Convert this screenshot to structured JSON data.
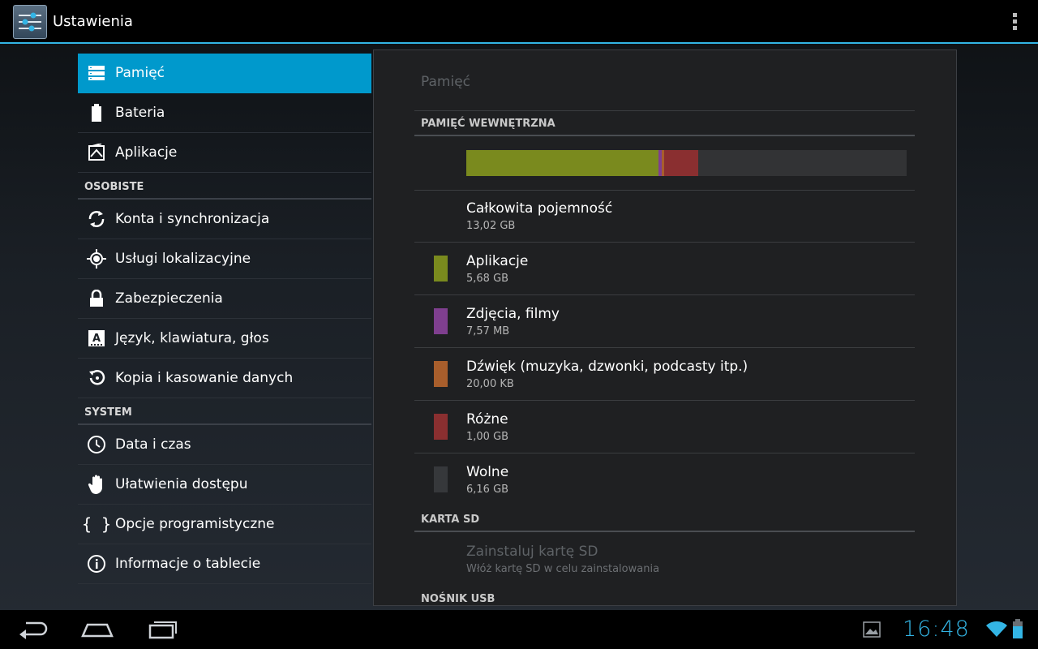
{
  "app": {
    "title": "Ustawienia"
  },
  "nav": {
    "items": [
      {
        "label": "Pamięć",
        "icon": "storage-icon",
        "selected": true
      },
      {
        "label": "Bateria",
        "icon": "battery-icon"
      },
      {
        "label": "Aplikacje",
        "icon": "apps-icon"
      }
    ],
    "header_personal": "OSOBISTE",
    "personal_items": [
      {
        "label": "Konta i synchronizacja",
        "icon": "sync-icon"
      },
      {
        "label": "Usługi lokalizacyjne",
        "icon": "location-icon"
      },
      {
        "label": "Zabezpieczenia",
        "icon": "lock-icon"
      },
      {
        "label": "Język, klawiatura, głos",
        "icon": "language-icon"
      },
      {
        "label": "Kopia i kasowanie danych",
        "icon": "backup-icon"
      }
    ],
    "header_system": "SYSTEM",
    "system_items": [
      {
        "label": "Data i czas",
        "icon": "clock-icon"
      },
      {
        "label": "Ułatwienia dostępu",
        "icon": "hand-icon"
      },
      {
        "label": "Opcje programistyczne",
        "icon": "braces-icon"
      },
      {
        "label": "Informacje o tablecie",
        "icon": "info-icon"
      }
    ]
  },
  "main": {
    "title": "Pamięć",
    "internal_header": "PAMIĘĆ WEWNĘTRZNA",
    "usage_bar": [
      {
        "name": "Aplikacje",
        "fraction": 0.436,
        "color": "#7a8a1e"
      },
      {
        "name": "Zdjęcia, filmy",
        "fraction": 0.008,
        "color": "#7f3f8f"
      },
      {
        "name": "Dźwięk",
        "fraction": 0.006,
        "color": "#a85e2c"
      },
      {
        "name": "Różne",
        "fraction": 0.077,
        "color": "#8a2f30"
      },
      {
        "name": "Wolne",
        "fraction": 0.473,
        "color": "#323335"
      }
    ],
    "total": {
      "label": "Całkowita pojemność",
      "value": "13,02 GB"
    },
    "rows": [
      {
        "label": "Aplikacje",
        "value": "5,68 GB",
        "color": "#7a8a1e"
      },
      {
        "label": "Zdjęcia, filmy",
        "value": "7,57 MB",
        "color": "#7f3f8f"
      },
      {
        "label": "Dźwięk (muzyka, dzwonki, podcasty itp.)",
        "value": "20,00 KB",
        "color": "#a85e2c"
      },
      {
        "label": "Różne",
        "value": "1,00 GB",
        "color": "#8a2f30"
      },
      {
        "label": "Wolne",
        "value": "6,16 GB",
        "color": "#36383b"
      }
    ],
    "sd_header": "KARTA SD",
    "sd_item": {
      "label": "Zainstaluj kartę SD",
      "value": "Włóż kartę SD w celu zainstalowania"
    },
    "usb_header": "NOŚNIK USB"
  },
  "system_bar": {
    "clock": "16:48",
    "buttons": [
      "back-icon",
      "home-icon",
      "recent-apps-icon"
    ],
    "status_icons": [
      "gallery-notification-icon",
      "wifi-icon",
      "battery-status-icon"
    ]
  },
  "colors": {
    "accent": "#33b5e5",
    "selected": "#0099cc"
  }
}
